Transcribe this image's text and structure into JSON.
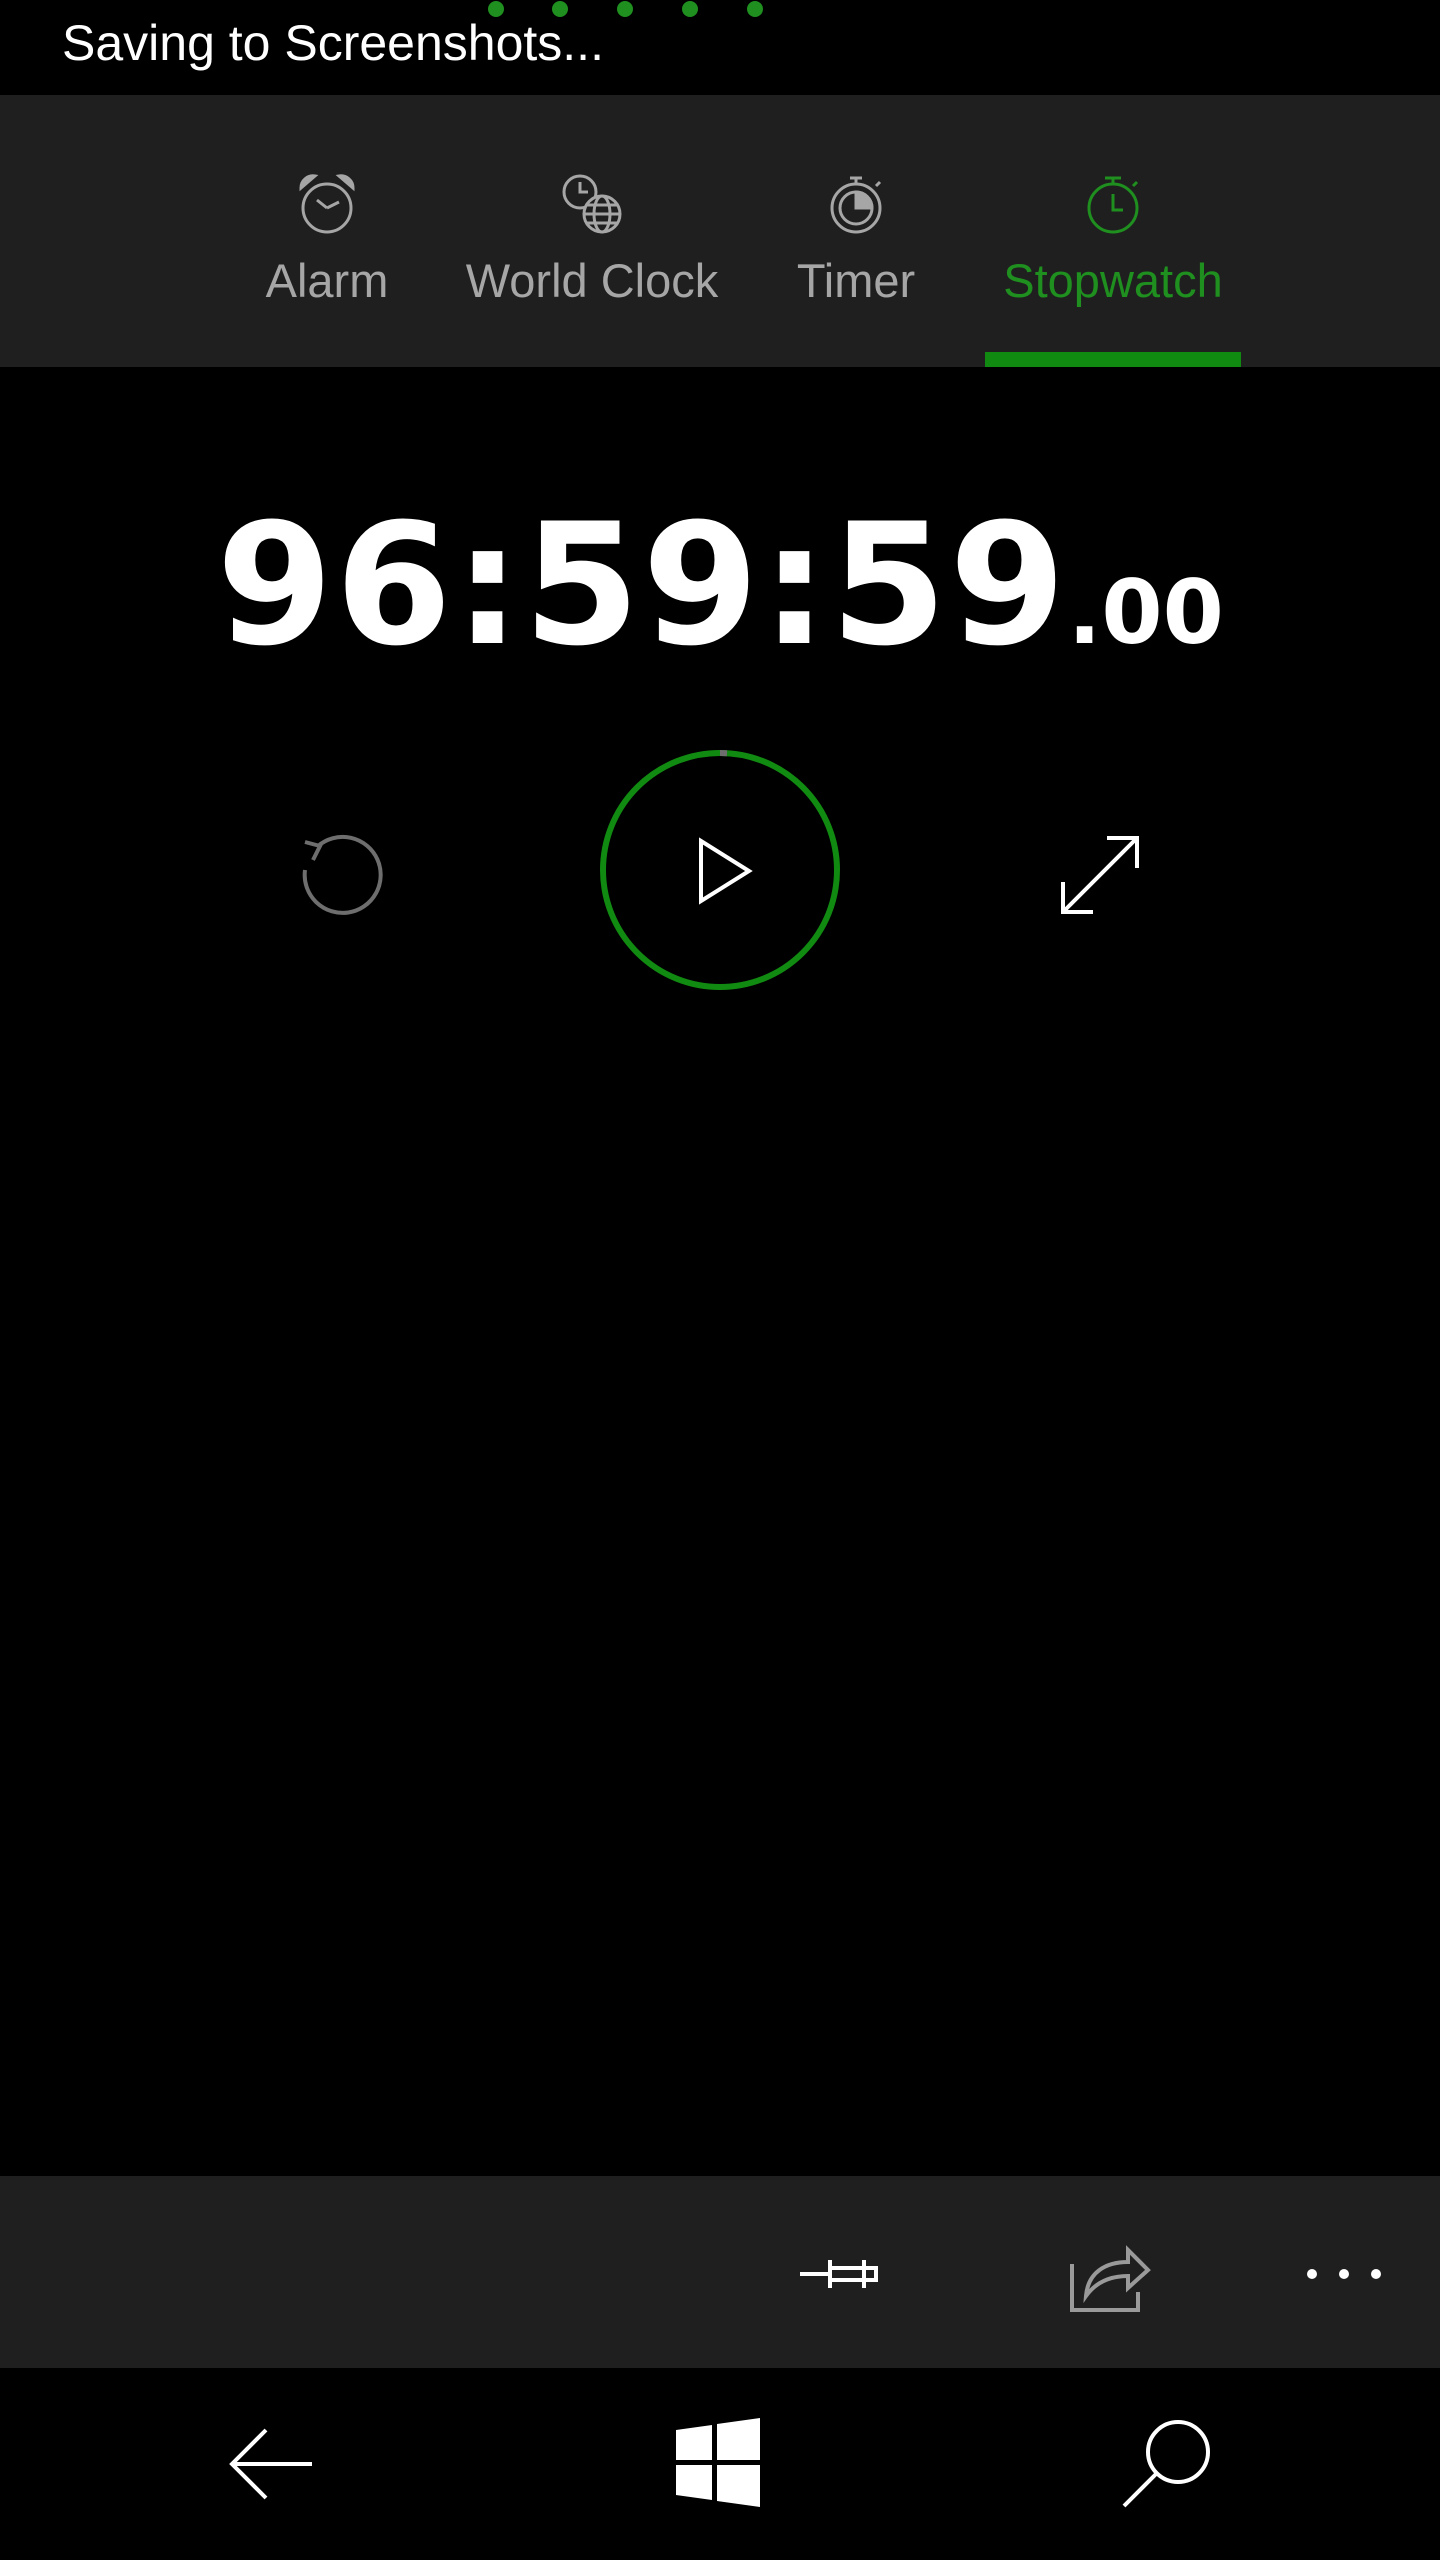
{
  "status": {
    "text": "Saving to Screenshots..."
  },
  "tabs": [
    {
      "label": "Alarm",
      "icon": "alarm-clock-icon",
      "active": false
    },
    {
      "label": "World Clock",
      "icon": "world-clock-icon",
      "active": false
    },
    {
      "label": "Timer",
      "icon": "timer-icon",
      "active": false
    },
    {
      "label": "Stopwatch",
      "icon": "stopwatch-icon",
      "active": true
    }
  ],
  "stopwatch": {
    "time_main": "96:59:59",
    "time_fraction": ".00"
  },
  "controls": {
    "reset_icon": "reset-icon",
    "play_icon": "play-icon",
    "expand_icon": "expand-icon"
  },
  "app_bar": {
    "pin_icon": "pin-icon",
    "share_icon": "share-icon",
    "more_label": "..."
  },
  "nav_bar": {
    "back_icon": "back-arrow-icon",
    "start_icon": "windows-logo-icon",
    "search_icon": "search-icon"
  },
  "colors": {
    "accent": "#118a11",
    "accent_text": "#1f8f1f",
    "background": "#000000",
    "bar_background": "#1f1f1f",
    "inactive_text": "#a6a6a6"
  }
}
